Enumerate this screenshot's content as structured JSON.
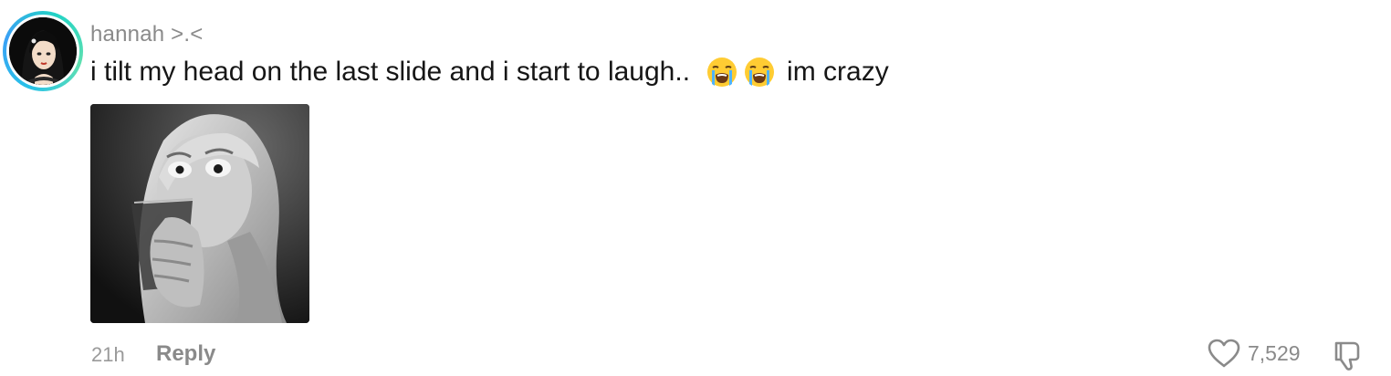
{
  "comment": {
    "username": "hannah >.<",
    "text_before": "i tilt my head on the last slide and i start to laugh..",
    "emojis": [
      "loudly-crying-face-icon",
      "loudly-crying-face-icon"
    ],
    "text_after": "im crazy",
    "attachment": "gif-image",
    "timestamp": "21h",
    "reply_label": "Reply",
    "like_count": "7,529"
  },
  "colors": {
    "avatar_ring": "#27c2e8",
    "meta_text": "#8a8a8a",
    "body_text": "#161616"
  }
}
